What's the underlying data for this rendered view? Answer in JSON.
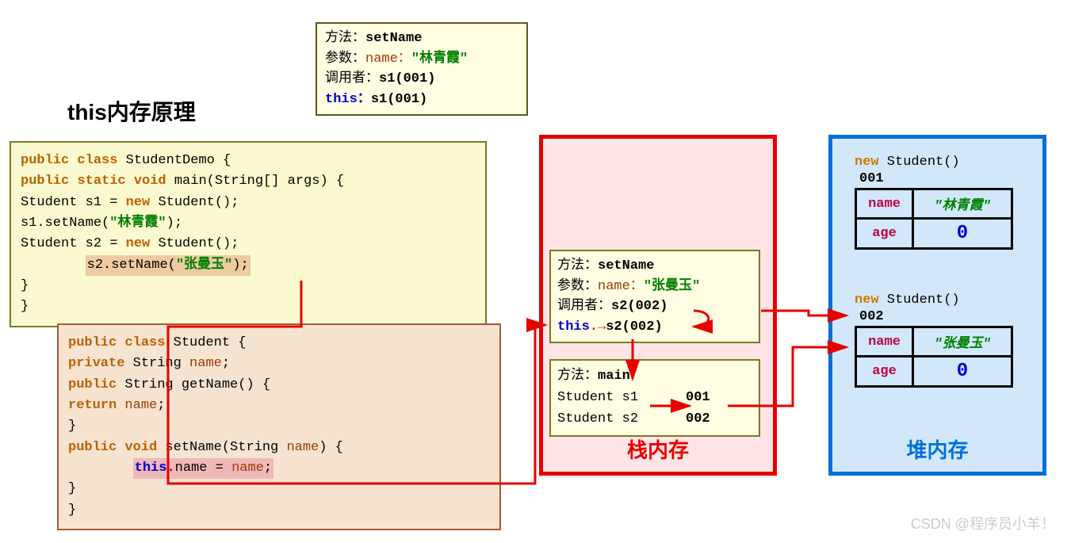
{
  "title": "this内存原理",
  "topFrame": {
    "l1a": "方法：",
    "l1b": "setName",
    "l2a": "参数：",
    "l2b": "name：",
    "l2c": "\"林青霞\"",
    "l3a": "调用者：",
    "l3b": "s1(",
    "l3c": "001",
    "l3d": ")",
    "l4a": "this：",
    "l4b": "s1(",
    "l4c": "001",
    "l4d": ")"
  },
  "code1": {
    "l1": "public class ",
    "l1b": "StudentDemo {",
    "l2": "    public static void ",
    "l2b": "main(String[] args) {",
    "l3a": "        Student s1 = ",
    "l3b": "new ",
    "l3c": "Student();",
    "l4a": "        s1.setName(",
    "l4b": "\"林青霞\"",
    "l4c": ");",
    "blank1": " ",
    "l5a": "        Student s2 = ",
    "l5b": "new ",
    "l5c": "Student();",
    "l6a": "        s2.setName(",
    "l6b": "\"张曼玉\"",
    "l6c": ");",
    "l7": "    }",
    "l8": "}"
  },
  "code2": {
    "l1a": "public class ",
    "l1b": "Student {",
    "l2a": "    private ",
    "l2b": "String ",
    "l2c": "name",
    "l2d": ";",
    "blank1": " ",
    "l3a": "    public ",
    "l3b": "String getName() {",
    "l4a": "        return ",
    "l4b": "name",
    "l4c": ";",
    "l5": "    }",
    "l6a": "    public void ",
    "l6b": "setName(String ",
    "l6c": "name",
    "l6d": ") {",
    "l7a": "        this",
    "l7b": ".name = ",
    "l7c": "name",
    "l7d": ";",
    "l8": "    }",
    "l9": "}"
  },
  "stack": {
    "titleText": "栈内存",
    "f1": {
      "l1a": "方法：",
      "l1b": "setName",
      "l2a": "参数：",
      "l2b": "name：",
      "l2c": "\"张曼玉\"",
      "l3a": "调用者：",
      "l3b": "s2(",
      "l3c": "002",
      "l3d": ")",
      "l4a": "this",
      "l4b": "s2(",
      "l4c": "002",
      "l4d": ")"
    },
    "f2": {
      "l1a": "方法：",
      "l1b": "main",
      "l2a": " Student ",
      "l2b": "s1",
      "l2c": "001",
      "l3a": " Student ",
      "l3b": "s2",
      "l3c": "002"
    }
  },
  "heap": {
    "titleText": "堆内存",
    "o1": {
      "hdr_new": "new",
      "hdr_type": " Student()",
      "addr": "001",
      "nameLabel": "name",
      "nameVal": "\"林青霞\"",
      "ageLabel": "age",
      "ageVal": "0"
    },
    "o2": {
      "hdr_new": "new",
      "hdr_type": " Student()",
      "addr": "002",
      "nameLabel": "name",
      "nameVal": "\"张曼玉\"",
      "ageLabel": "age",
      "ageVal": "0"
    }
  },
  "watermark": "CSDN @程序员小羊！"
}
